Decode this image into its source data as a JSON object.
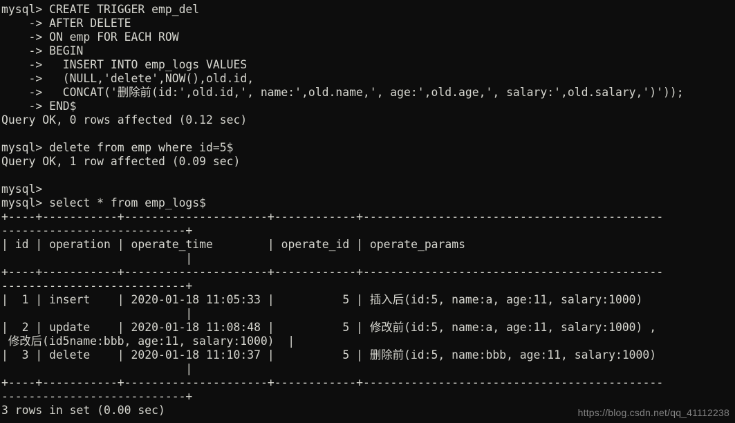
{
  "terminal": {
    "prompt": "mysql>",
    "continuation_prompt": "->",
    "delimiter": "$",
    "colors": {
      "background": "#0d0d0d",
      "foreground": "#d6d6cf",
      "watermark": "#8d8d8d"
    },
    "lines": [
      "mysql> CREATE TRIGGER emp_del",
      "    -> AFTER DELETE",
      "    -> ON emp FOR EACH ROW",
      "    -> BEGIN",
      "    ->   INSERT INTO emp_logs VALUES",
      "    ->   (NULL,'delete',NOW(),old.id,",
      "    ->   CONCAT('删除前(id:',old.id,', name:',old.name,', age:',old.age,', salary:',old.salary,')'));",
      "    -> END$",
      "Query OK, 0 rows affected (0.12 sec)",
      "",
      "mysql> delete from emp where id=5$",
      "Query OK, 1 row affected (0.09 sec)",
      "",
      "mysql>",
      "mysql> select * from emp_logs$",
      "+----+-----------+---------------------+------------+--------------------------------------------",
      "---------------------------+",
      "| id | operation | operate_time        | operate_id | operate_params",
      "                           |",
      "+----+-----------+---------------------+------------+--------------------------------------------",
      "---------------------------+",
      "|  1 | insert    | 2020-01-18 11:05:33 |          5 | 插入后(id:5, name:a, age:11, salary:1000)",
      "                           |",
      "|  2 | update    | 2020-01-18 11:08:48 |          5 | 修改前(id:5, name:a, age:11, salary:1000) ,",
      " 修改后(id5name:bbb, age:11, salary:1000)  |",
      "|  3 | delete    | 2020-01-18 11:10:37 |          5 | 删除前(id:5, name:bbb, age:11, salary:1000)",
      "                           |",
      "+----+-----------+---------------------+------------+--------------------------------------------",
      "---------------------------+",
      "3 rows in set (0.00 sec)"
    ]
  },
  "watermark": {
    "text": "https://blog.csdn.net/qq_41112238"
  }
}
